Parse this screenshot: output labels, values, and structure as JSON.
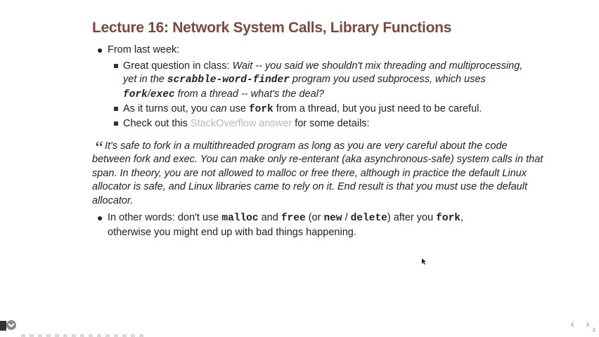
{
  "title": "Lecture 16: Network System Calls, Library Functions",
  "bullets": {
    "b1": "From last week:",
    "sub1": {
      "l1a": "Great question in class: ",
      "l1b": "Wait -- you said we shouldn't mix threading and multiprocessing,",
      "l2a": "yet in the ",
      "l2code": "scrabble-word-finder",
      "l2b": " program you used subprocess, which uses",
      "l3code1": "fork",
      "l3slash": "/",
      "l3code2": "exec",
      "l3b": " from a thread -- what's the deal?"
    },
    "sub2": {
      "a": "As it turns out, you ",
      "can": "can",
      "b": " use ",
      "code": "fork",
      "c": " from a thread, but you just need to be careful."
    },
    "sub3": {
      "a": "Check out this ",
      "link": "StackOverflow answer",
      "b": " for some details:"
    }
  },
  "quote": {
    "mark": "“",
    "l1": "It's safe to fork in a multithreaded program as long as you are very careful about the code",
    "l2": "between fork and exec. You can make only re-enterant (aka asynchronous-safe) system calls in that",
    "l3": "span. In theory, you are not allowed to malloc or free there, although in practice the default Linux",
    "l4": "allocator is safe, and Linux libraries came to rely on it. End result is that you must use the default",
    "l5": "allocator."
  },
  "other": {
    "a": "In other words: don't use ",
    "c1": "malloc",
    "b": " and ",
    "c2": "free",
    "c": " (or ",
    "c3": "new",
    "d": " / ",
    "c4": "delete",
    "e": ") after you ",
    "c5": "fork",
    "f": ",",
    "l2": "otherwise you might end up with bad things happening."
  },
  "footer": {
    "nav_prev": "‹",
    "nav_next": "›",
    "page": "2"
  },
  "colors": {
    "title": "#7a4a3c",
    "link": "#b8b8b8"
  }
}
